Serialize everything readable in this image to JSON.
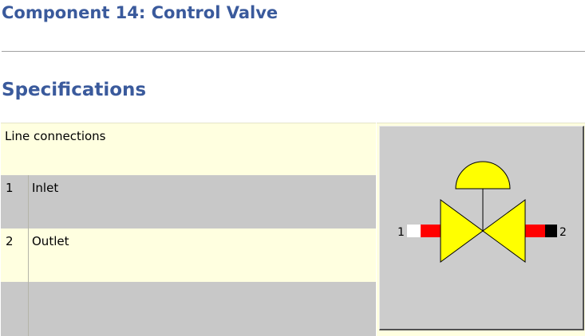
{
  "page": {
    "title": "Component 14: Control Valve",
    "section_heading": "Specifications"
  },
  "table": {
    "header": "Line connections",
    "rows": [
      {
        "number": "1",
        "label": "Inlet"
      },
      {
        "number": "2",
        "label": "Outlet"
      }
    ]
  },
  "symbol": {
    "port_left": "1",
    "port_right": "2",
    "colors": {
      "valve_fill": "#ffff00",
      "pipe_red": "#ff0000",
      "inlet_marker": "#ffffff",
      "outlet_marker": "#000000",
      "panel_bg": "#cccccc"
    }
  }
}
